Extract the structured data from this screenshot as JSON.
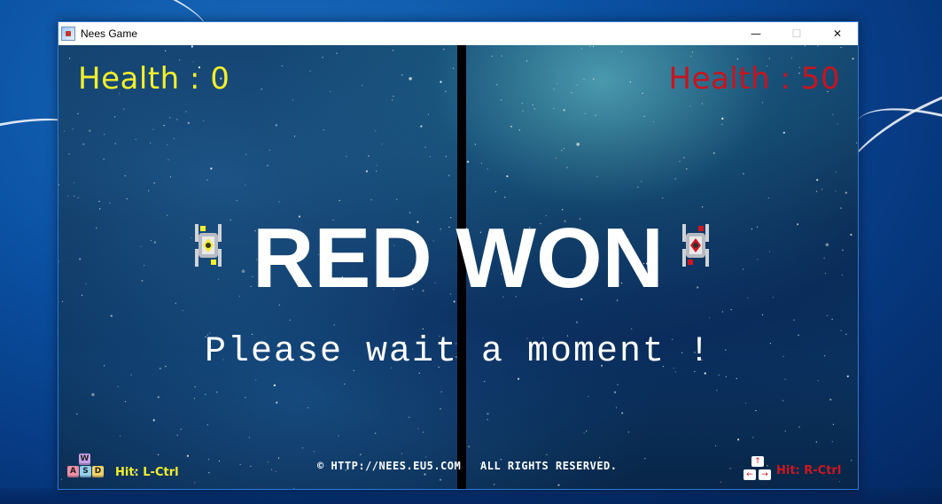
{
  "window": {
    "title": "Nees Game",
    "controls": {
      "minimize": "—",
      "maximize": "☐",
      "close": "✕"
    }
  },
  "hud": {
    "left_health": "Health : 0",
    "right_health": "Health : 50",
    "left_color": "#f4ef2a",
    "right_color": "#c8141e"
  },
  "message": {
    "winner": "RED WON",
    "wait": "Please wait a moment !"
  },
  "footer": {
    "copyright": "© HTTP://NEES.EU5.COM",
    "rights": "ALL RIGHTS RESERVED.",
    "left_keys": [
      "W",
      "A",
      "S",
      "D"
    ],
    "left_hint": "Hit: L-Ctrl",
    "right_keys": [
      "↑",
      "←",
      "↓",
      "→"
    ],
    "right_hint": "Hit: R-Ctrl"
  },
  "icons": {
    "app": "app-icon",
    "yellow_ship": "yellow-spaceship-icon",
    "red_ship": "red-spaceship-icon"
  }
}
